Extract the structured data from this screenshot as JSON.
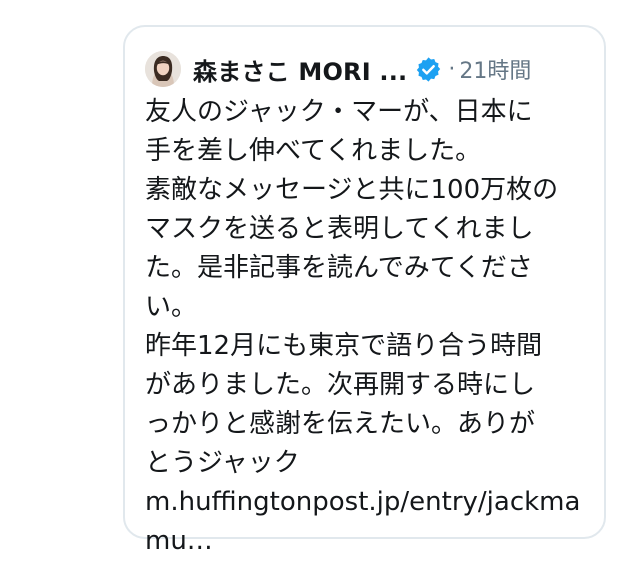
{
  "tweet": {
    "author": {
      "display_name": "森まさこ MORI ...",
      "verified": true
    },
    "meta": {
      "separator": "·",
      "timestamp": "21時間"
    },
    "text": "友人のジャック・マーが、日本に\n手を差し伸べてくれました。\n素敵なメッセージと共に100万枚の\nマスクを送ると表明してくれまし\nた。是非記事を読んでみてくださ\nい。\n昨年12月にも東京で語り合う時間\nがありました。次再開する時にし\nっかりと感謝を伝えたい。ありが\nとうジャック",
    "link": {
      "line1": "m.huffingtonpost.jp/entry/jackma",
      "line2": "mu…"
    }
  },
  "icons": {
    "avatar": "profile-photo",
    "verified": "verified-badge-icon"
  },
  "colors": {
    "card_border": "#e1e8ed",
    "text": "#14171a",
    "muted": "#657786",
    "verified_blue": "#1da1f2"
  }
}
